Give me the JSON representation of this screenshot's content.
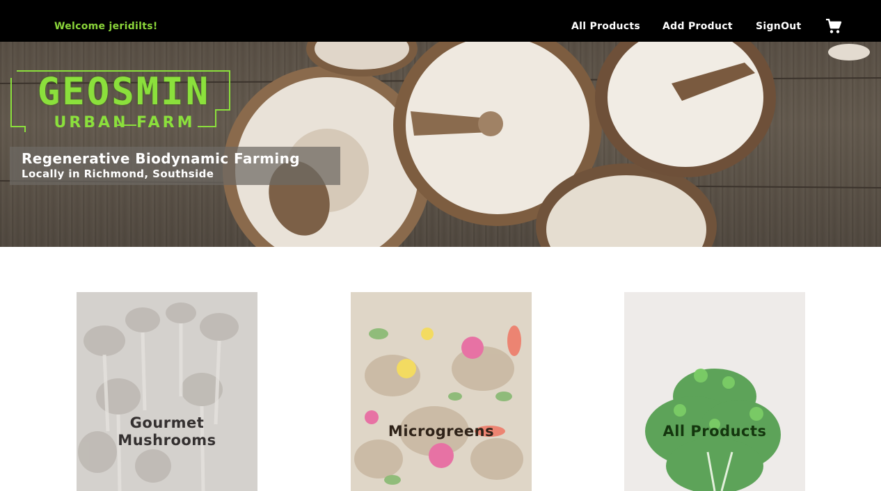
{
  "header": {
    "welcome": "Welcome jeridilts!",
    "nav": {
      "all_products": "All Products",
      "add_product": "Add Product",
      "signout": "SignOut",
      "cart_icon": "shopping-cart-icon"
    }
  },
  "hero": {
    "logo": {
      "title": "GEOSMIN",
      "subtitle": "URBAN FARM"
    },
    "tagline": "Regenerative Biodynamic Farming",
    "subtagline": "Locally in Richmond, Southside"
  },
  "categories": [
    {
      "label_line1": "Gourmet",
      "label_line2": "Mushrooms"
    },
    {
      "label": "Microgreens"
    },
    {
      "label": "All Products"
    }
  ],
  "colors": {
    "nav_background": "#000000",
    "welcome_text": "#8bd63a",
    "logo_green": "#8be03c",
    "nav_text": "#ffffff"
  }
}
